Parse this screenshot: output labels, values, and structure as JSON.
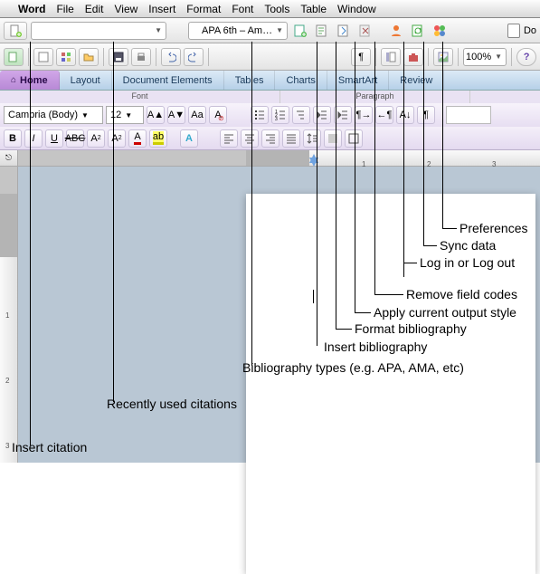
{
  "menubar": {
    "app": "Word",
    "items": [
      "File",
      "Edit",
      "View",
      "Insert",
      "Format",
      "Font",
      "Tools",
      "Table",
      "Window"
    ]
  },
  "citationToolbar": {
    "recentPlaceholder": "",
    "bibStyle": "APA 6th – Am…"
  },
  "docIndicator": "Do",
  "zoom": "100%",
  "ribbonTabs": [
    "Home",
    "Layout",
    "Document Elements",
    "Tables",
    "Charts",
    "SmartArt",
    "Review"
  ],
  "ribbonGroups": {
    "font": "Font",
    "para": "Paragraph"
  },
  "font": {
    "name": "Cambria (Body)",
    "size": "12"
  },
  "callouts": {
    "preferences": "Preferences",
    "sync": "Sync data",
    "login": "Log in or Log out",
    "removeCodes": "Remove field codes",
    "applyStyle": "Apply current output style",
    "formatBib": "Format bibliography",
    "insertBib": "Insert bibliography",
    "bibTypes": "Bibliography types (e.g. APA, AMA, etc)",
    "recent": "Recently used citations",
    "insertCit": "Insert citation"
  }
}
